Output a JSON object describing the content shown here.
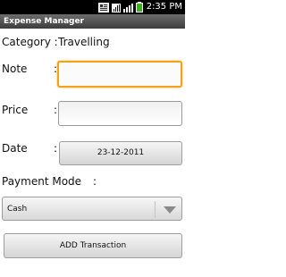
{
  "status_bar": {
    "time": "2:35 PM"
  },
  "app": {
    "title": "Expense Manager"
  },
  "category": {
    "label": "Category :",
    "value": "Travelling"
  },
  "note": {
    "label": "Note",
    "colon": ":",
    "value": ""
  },
  "price": {
    "label": "Price",
    "colon": ":",
    "value": ""
  },
  "date": {
    "label": "Date",
    "colon": ":",
    "value": "23-12-2011"
  },
  "payment": {
    "label": "Payment Mode",
    "colon": ":",
    "selected": "Cash"
  },
  "actions": {
    "add_label": "ADD Transaction"
  }
}
